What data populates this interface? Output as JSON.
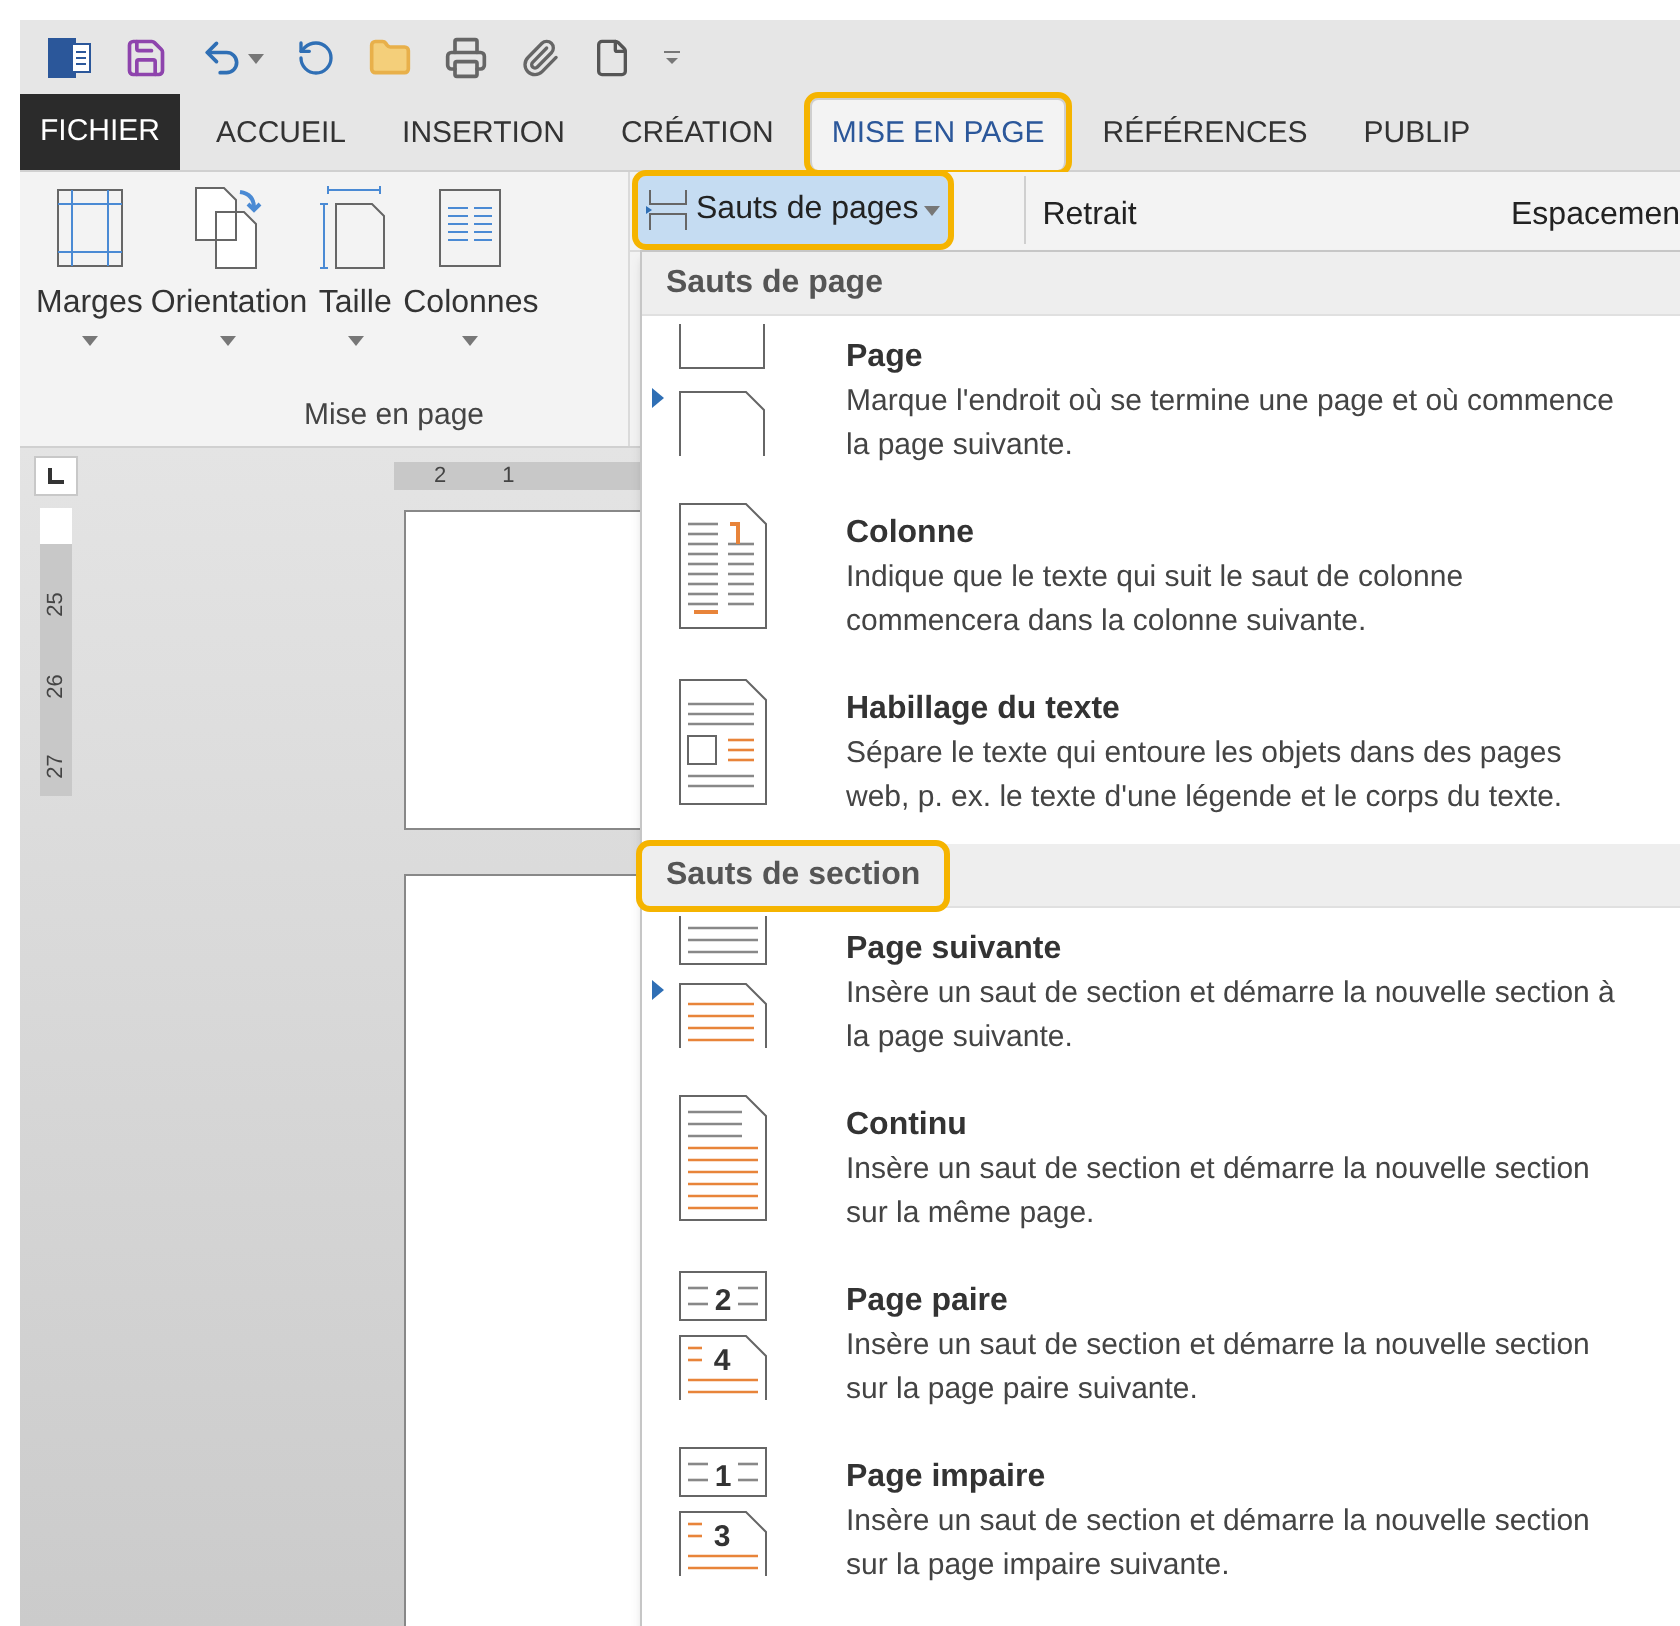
{
  "tabs": [
    {
      "label": "FICHIER",
      "kind": "file",
      "selected": false,
      "highlighted": false
    },
    {
      "label": "ACCUEIL",
      "kind": "tab",
      "selected": false,
      "highlighted": false
    },
    {
      "label": "INSERTION",
      "kind": "tab",
      "selected": false,
      "highlighted": false
    },
    {
      "label": "CRÉATION",
      "kind": "tab",
      "selected": false,
      "highlighted": false
    },
    {
      "label": "MISE EN PAGE",
      "kind": "tab",
      "selected": true,
      "highlighted": true
    },
    {
      "label": "RÉFÉRENCES",
      "kind": "tab",
      "selected": false,
      "highlighted": false
    },
    {
      "label": "PUBLIP",
      "kind": "tab",
      "selected": false,
      "highlighted": false
    }
  ],
  "ribbon": {
    "buttons": [
      {
        "label": "Marges",
        "kind": "margins"
      },
      {
        "label": "Orientation",
        "kind": "orientation"
      },
      {
        "label": "Taille",
        "kind": "size"
      },
      {
        "label": "Colonnes",
        "kind": "columns"
      }
    ],
    "group_label": "Mise en page",
    "breaks_button": {
      "label": "Sauts de pages",
      "highlighted": true,
      "pressed": true
    },
    "indent_label": "Retrait",
    "spacing_label": "Espacemen"
  },
  "rulers": {
    "horizontal": [
      "2",
      "1"
    ],
    "vertical": [
      "25",
      "26",
      "27"
    ]
  },
  "menu": {
    "sections": [
      {
        "header": "Sauts de page",
        "highlighted": false,
        "items": [
          {
            "kind": "page",
            "title": "Page",
            "description": "Marque l'endroit où se termine une page et où commence la page suivante.",
            "marker": true
          },
          {
            "kind": "column",
            "title": "Colonne",
            "description": "Indique que le texte qui suit le saut de colonne commencera dans la colonne suivante.",
            "marker": false
          },
          {
            "kind": "wrap",
            "title": "Habillage du texte",
            "description": "Sépare le texte qui entoure les objets dans des pages web, p. ex. le texte d'une légende et le corps du texte.",
            "marker": false
          }
        ]
      },
      {
        "header": "Sauts de section",
        "highlighted": true,
        "items": [
          {
            "kind": "next",
            "title": "Page suivante",
            "description": "Insère un saut de section et démarre la nouvelle section à la page suivante.",
            "marker": true
          },
          {
            "kind": "continuous",
            "title": "Continu",
            "description": "Insère un saut de section et démarre la nouvelle section sur la même page.",
            "marker": false
          },
          {
            "kind": "even",
            "title": "Page paire",
            "description": "Insère un saut de section et démarre la nouvelle section sur la page paire suivante.",
            "marker": false,
            "digits": [
              "2",
              "4"
            ]
          },
          {
            "kind": "odd",
            "title": "Page impaire",
            "description": "Insère un saut de section et démarre la nouvelle section sur la page impaire suivante.",
            "marker": false,
            "digits": [
              "1",
              "3"
            ]
          }
        ]
      }
    ]
  }
}
